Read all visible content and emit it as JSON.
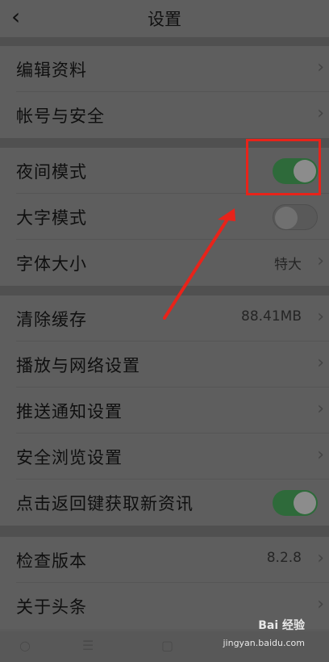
{
  "header": {
    "title": "设置",
    "back_icon": "chevron-left-icon"
  },
  "group1": [
    {
      "label": "编辑资料"
    },
    {
      "label": "帐号与安全"
    }
  ],
  "group2": {
    "night_mode": {
      "label": "夜间模式",
      "on": true
    },
    "large_text": {
      "label": "大字模式",
      "on": false
    },
    "font_size": {
      "label": "字体大小",
      "value": "特大"
    }
  },
  "group3": {
    "clear_cache": {
      "label": "清除缓存",
      "value": "88.41MB"
    },
    "playback": {
      "label": "播放与网络设置"
    },
    "push": {
      "label": "推送通知设置"
    },
    "safe_browse": {
      "label": "安全浏览设置"
    },
    "back_refresh": {
      "label": "点击返回键获取新资讯",
      "on": true
    }
  },
  "group4": {
    "check_version": {
      "label": "检查版本",
      "value": "8.2.8"
    },
    "about": {
      "label": "关于头条"
    }
  },
  "watermark": {
    "line1": "Bai 经验",
    "line2": "jingyan.baidu.com"
  },
  "colors": {
    "toggle_on": "#2e6a3a",
    "highlight": "#e8231a"
  }
}
